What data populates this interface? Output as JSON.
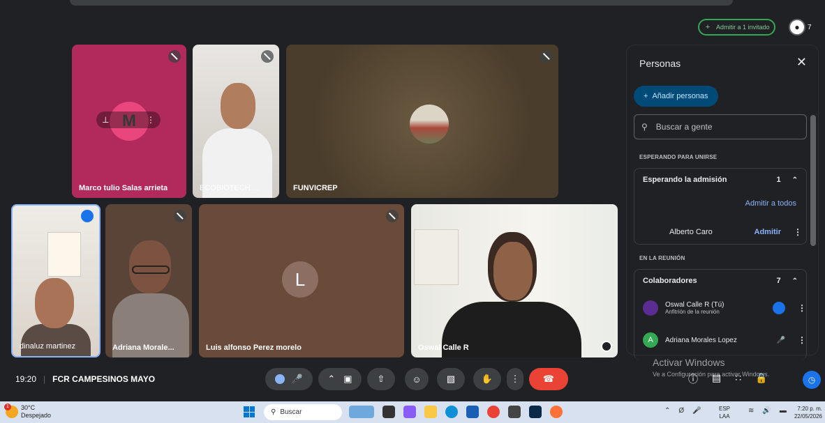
{
  "top": {
    "admit_guest_label": "Admitir a 1 invitado",
    "people_count": "7"
  },
  "tiles": {
    "marco": {
      "name": "Marco tulio Salas arrieta",
      "initial": "M"
    },
    "ecobio": {
      "name": "ECOBIOTECH ..."
    },
    "funvic": {
      "name": "FUNVICREP"
    },
    "dina": {
      "name": "dinaluz martinez"
    },
    "adri": {
      "name": "Adriana Morale..."
    },
    "luis": {
      "name": "Luis alfonso Perez morelo",
      "initial": "L"
    },
    "oswal": {
      "name": "Oswal Calle R"
    }
  },
  "panel": {
    "title": "Personas",
    "add_people": "Añadir personas",
    "search_placeholder": "Buscar a gente",
    "waiting_section": "ESPERANDO PARA UNIRSE",
    "waiting_group": "Esperando la admisión",
    "waiting_count": "1",
    "admit_all": "Admitir a todos",
    "waiting_person": "Alberto Caro",
    "admit": "Admitir",
    "meeting_section": "EN LA REUNIÓN",
    "collab_group": "Colaboradores",
    "collab_count": "7",
    "members": [
      {
        "name": "Oswal Calle R (Tú)",
        "role": "Anfitrión de la reunión",
        "initial": ""
      },
      {
        "name": "Adriana Morales Lopez",
        "role": "",
        "initial": "A"
      }
    ]
  },
  "bottom": {
    "time": "19:20",
    "meeting_name": "FCR CAMPESINOS MAYO",
    "activate_title": "Activar Windows",
    "activate_sub": "Ve a Configuración para activar Windows."
  },
  "taskbar": {
    "temp": "30°C",
    "weather": "Despejado",
    "search": "Buscar",
    "lang1": "ESP",
    "lang2": "LAA",
    "clock_time": "7:20 p. m.",
    "clock_date": "22/05/2026"
  },
  "colors": {
    "accent_blue": "#8ab4f8",
    "leave_red": "#ea4335",
    "admit_green": "#34a853"
  }
}
